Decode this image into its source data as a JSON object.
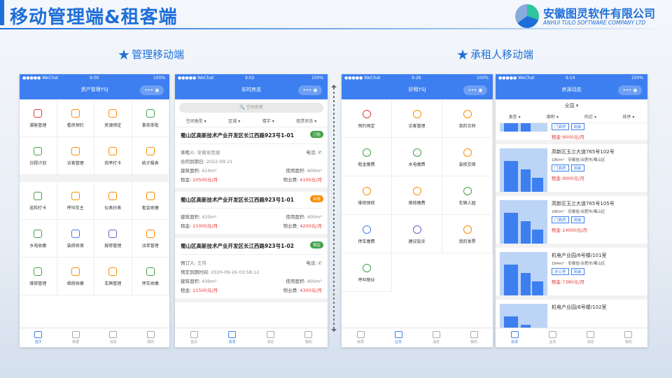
{
  "slide_title": "移动管理端&租客端",
  "logo": {
    "cn": "安徽图灵软件有限公司",
    "en": "ANHUI TULO SOFTWARE COMPANY LTD"
  },
  "sections": {
    "left": "管理移动端",
    "right": "承租人移动端"
  },
  "status": {
    "carrier": "●●●●● WeChat",
    "battery": "100%"
  },
  "capsule": "•••",
  "phone1": {
    "time": "9:00",
    "title": "资产管理YSJ",
    "grid_top": [
      "潮客管理",
      "看房预约",
      "房源预定",
      "事务审批",
      "日程计划",
      "访客管理",
      "岗亭打卡",
      "统计报表"
    ],
    "grid_bottom": [
      "巡检打卡",
      "呼叫车主",
      "仪表抄表",
      "租金收缴",
      "水电收缴",
      "装修收保",
      "报修管理",
      "派单管理",
      "维修管理",
      "维修收缴",
      "车辆管理",
      "停车收缴"
    ],
    "tabs": [
      "首页",
      "数据",
      "消息",
      "我的"
    ]
  },
  "phone2": {
    "time": "9:02",
    "title": "实时房态",
    "search": "空间名称",
    "filters": [
      "空间类型",
      "区域",
      "楼宇",
      "租赁状态"
    ],
    "cards": [
      {
        "addr": "蜀山区高新技术产业开发区长江西路923号1-01",
        "badge": "已租",
        "color": "#43a047",
        "rows": [
          [
            "承租人:",
            "安徽易思捷",
            "电话:",
            ""
          ],
          [
            "合同到期日:",
            "2022-09-21",
            "",
            ""
          ],
          [
            "建筑面积:",
            "410m²",
            "使用面积:",
            "400m²"
          ],
          [
            "租金:",
            "20500元/月",
            "物业费:",
            "4100元/月"
          ]
        ]
      },
      {
        "addr": "蜀山区高新技术产业开发区长江西路923号1-01",
        "badge": "未租",
        "color": "#fb8c00",
        "rows": [
          [
            "建筑面积:",
            "420m²",
            "使用面积:",
            "400m²"
          ],
          [
            "租金:",
            "21000元/月",
            "物业费:",
            "4200元/月"
          ]
        ]
      },
      {
        "addr": "蜀山区高新技术产业开发区长江西路923号1-02",
        "badge": "预定",
        "color": "#43a047",
        "rows": [
          [
            "预订人:",
            "王伟",
            "电话:",
            ""
          ],
          [
            "预定到期时间:",
            "2020-09-26 03:58:12",
            "",
            ""
          ],
          [
            "建筑面积:",
            "430m²",
            "使用面积:",
            "400m²"
          ],
          [
            "租金:",
            "21500元/月",
            "物业费:",
            "4300元/月"
          ]
        ]
      }
    ],
    "tabs": [
      "首页",
      "房态",
      "消息",
      "我的"
    ]
  },
  "phone3": {
    "time": "9:26",
    "title": "好租YSJ",
    "grid": [
      "预约预定",
      "访客管理",
      "我的合同",
      "租金缴费",
      "水电缴费",
      "装修交保",
      "维修保修",
      "维修缴费",
      "车辆入园",
      "停车缴费",
      "建议投诉",
      "我的发票",
      "呼叫物业"
    ],
    "tabs": [
      "房源",
      "业务",
      "消息",
      "我的"
    ]
  },
  "phone4": {
    "time": "9:14",
    "title": "房源动态",
    "city": "全国",
    "filters": [
      "类型",
      "面积",
      "附近",
      "排序"
    ],
    "partial": {
      "tags": [
        "门面房",
        "简装"
      ],
      "price": "租金:9000元/月"
    },
    "listings": [
      {
        "name": "高新区玉兰大道765号102号",
        "sub": "180m² · 安徽省/合肥市/蜀山区",
        "tags": [
          "门面房",
          "简装"
        ],
        "price": "租金:9000元/月"
      },
      {
        "name": "高新区玉兰大道765号105号",
        "sub": "280m² · 安徽省/合肥市/蜀山区",
        "tags": [
          "门面房",
          "简装"
        ],
        "price": "租金:14000元/月"
      },
      {
        "name": "机电产业园/6号楼/101室",
        "sub": "164m² · 安徽省/合肥市/蜀山区",
        "tags": [
          "办公室",
          "简装"
        ],
        "price": "租金:7380元/月"
      },
      {
        "name": "机电产业园/6号楼/102室",
        "sub": "",
        "tags": [],
        "price": ""
      }
    ],
    "tabs": [
      "房源",
      "业务",
      "消息",
      "我的"
    ]
  }
}
